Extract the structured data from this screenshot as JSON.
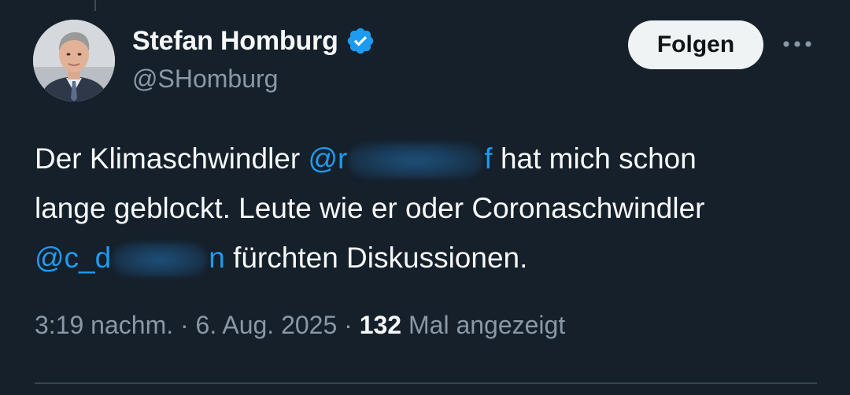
{
  "author": {
    "display_name": "Stefan Homburg",
    "handle": "@SHomburg",
    "verified": true,
    "avatar_icon": "user-portrait-avatar"
  },
  "actions": {
    "follow_label": "Folgen",
    "more_icon": "more-horizontal-icon"
  },
  "tweet": {
    "lines": [
      {
        "before": "Der Klimaschwindler ",
        "mention_start": "@r",
        "mention_end": "f",
        "after": " hat mich schon"
      },
      {
        "text": "lange geblockt. Leute wie er oder Coronaschwindler"
      },
      {
        "mention_start": "@c_d",
        "mention_end": "n",
        "after": " fürchten Diskussionen."
      }
    ]
  },
  "meta": {
    "time": "3:19 nachm.",
    "separator": " · ",
    "date": "6. Aug. 2025",
    "views_count": "132",
    "views_label": " Mal angezeigt"
  },
  "colors": {
    "background": "#15202b",
    "text_primary": "#f7f9f9",
    "text_secondary": "#8b98a5",
    "link": "#1d9bf0",
    "verified": "#1d9bf0",
    "follow_bg": "#eff3f4"
  }
}
